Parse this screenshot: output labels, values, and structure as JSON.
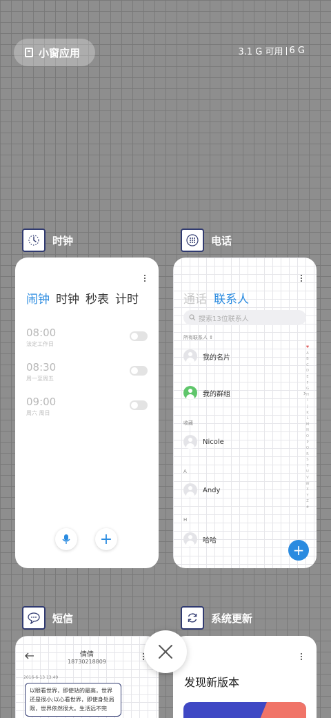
{
  "top": {
    "mini_label": "小窗应用",
    "mem_available": "3.1 G 可用",
    "mem_total": "6 G"
  },
  "clock": {
    "title": "时钟",
    "tabs": [
      "闹钟",
      "时钟",
      "秒表",
      "计时"
    ],
    "alarms": [
      {
        "time": "08:00",
        "days": "法定工作日"
      },
      {
        "time": "08:30",
        "days": "周一至周五"
      },
      {
        "time": "09:00",
        "days": "周六 周日"
      }
    ],
    "fab_add": "+"
  },
  "phone": {
    "title": "电话",
    "tabs": [
      "通话",
      "联系人"
    ],
    "search_placeholder": "搜索13位联系人",
    "all_label": "所有联系人",
    "my_card": "我的名片",
    "my_group": "我的群组",
    "fav_label": "收藏",
    "contacts": [
      {
        "section": "",
        "name": "Nicole"
      },
      {
        "section": "A",
        "name": "Andy"
      },
      {
        "section": "H",
        "name": "哈哈"
      }
    ],
    "alphabet": [
      "♥",
      "A",
      "B",
      "C",
      "D",
      "E",
      "F",
      "G",
      "H",
      "I",
      "J",
      "K",
      "L",
      "M",
      "N",
      "O",
      "P",
      "Q",
      "R",
      "S",
      "T",
      "U",
      "V",
      "W",
      "X",
      "Y",
      "Z",
      "#"
    ],
    "fab_add": "+"
  },
  "sms": {
    "title": "短信",
    "contact_name": "倩倩",
    "contact_phone": "18730218809",
    "timestamp": "2016-6-13 13:49",
    "message": "以眼看世界，即使站的最高，世界还是很小;以心看世界，即使身处局限，世界依然很大。生活远不完"
  },
  "update": {
    "title": "系统更新",
    "heading": "发现新版本"
  },
  "colors": {
    "accent": "#2a8be0",
    "icon_border": "#303a70"
  }
}
